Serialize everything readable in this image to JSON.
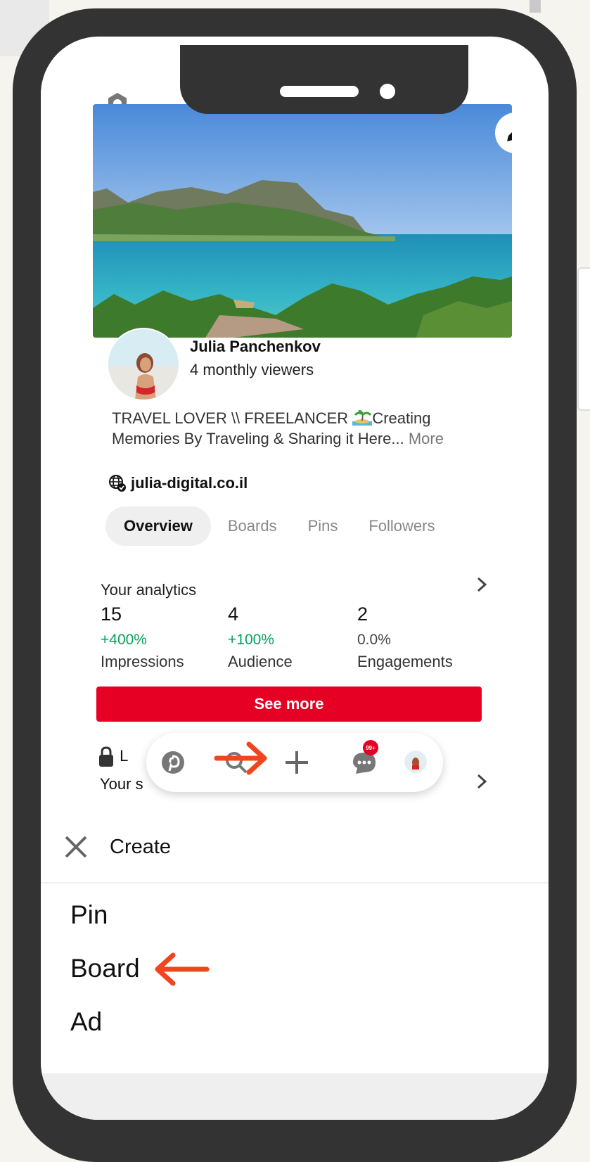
{
  "profile": {
    "name": "Julia Panchenkov",
    "viewers": "4 monthly viewers",
    "bio": "TRAVEL LOVER \\\\ FREELANCER",
    "bio_rest_1": "Creating",
    "bio_rest_2": "Memories By Traveling & Sharing it Here...",
    "more_label": "More",
    "website": "julia-digital.co.il"
  },
  "tabs": [
    "Overview",
    "Boards",
    "Pins",
    "Followers"
  ],
  "analytics": {
    "title": "Your analytics",
    "metrics": [
      {
        "value": "15",
        "change": "+400%",
        "label": "Impressions"
      },
      {
        "value": "4",
        "change": "+100%",
        "label": "Audience"
      },
      {
        "value": "2",
        "change": "0.0%",
        "label": "Engagements"
      }
    ],
    "see_more": "See more"
  },
  "partial_rows": {
    "lock_row": "L",
    "your_row": "Your s"
  },
  "navbar": {
    "items": [
      "pinterest-icon",
      "search-icon",
      "plus-icon",
      "messages-icon",
      "profile-avatar"
    ],
    "badge": "99+"
  },
  "create": {
    "title": "Create",
    "options": [
      "Pin",
      "Board",
      "Ad"
    ]
  },
  "colors": {
    "accent": "#e60023",
    "positive": "#00a35b",
    "annotation_arrow": "#f0461e",
    "phone_frame": "#333333"
  }
}
